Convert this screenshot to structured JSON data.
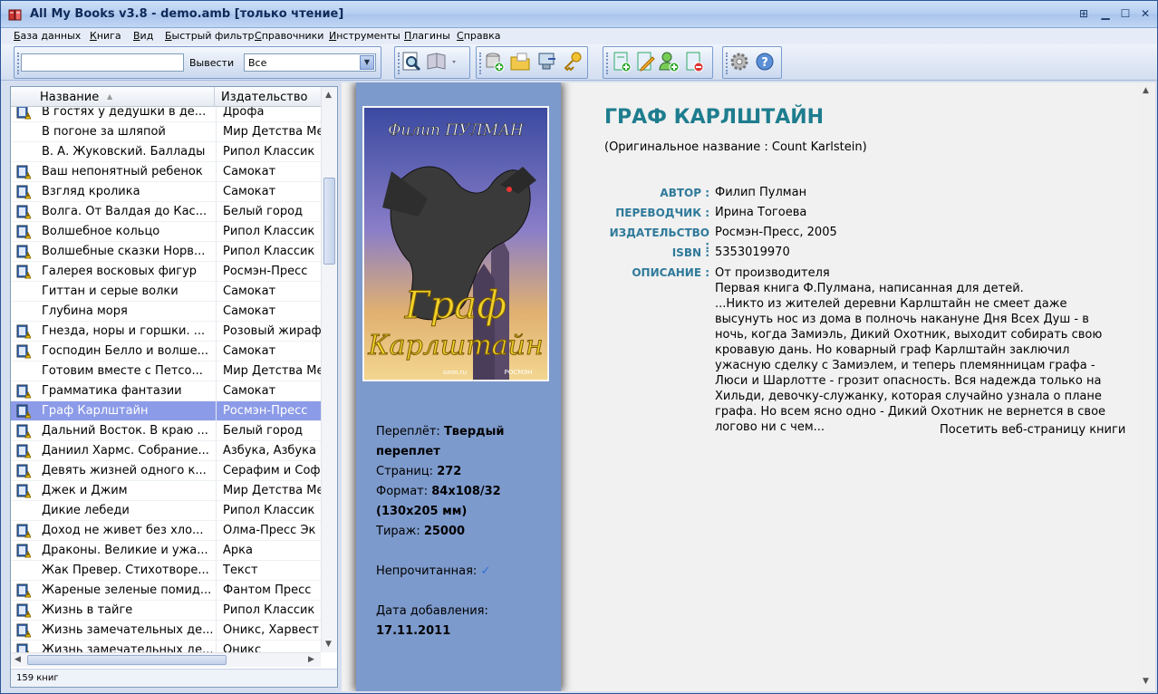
{
  "window": {
    "title": "All My Books v3.8 - demo.amb [только чтение]"
  },
  "menu": [
    "База данных",
    "Книга",
    "Вид",
    "Быстрый фильтр",
    "Справочники",
    "Инструменты",
    "Плагины",
    "Справка"
  ],
  "toolbar": {
    "search_value": "",
    "output_label": "Вывести",
    "filter_value": "Все",
    "icons": [
      "preview-icon",
      "reader-icon",
      "add-db-icon",
      "open-folder-icon",
      "export-icon",
      "key-icon",
      "add-book-icon",
      "edit-book-icon",
      "add-user-icon",
      "delete-book-icon",
      "settings-icon",
      "help-icon"
    ]
  },
  "list": {
    "col_title": "Название",
    "col_publisher": "Издательство",
    "rows": [
      {
        "title": "В гостях у дедушки в де...",
        "publisher": "Дрофа",
        "icon": true
      },
      {
        "title": "В погоне за шляпой",
        "publisher": "Мир Детства Ме",
        "icon": false
      },
      {
        "title": "В. А. Жуковский. Баллады",
        "publisher": "Рипол Классик",
        "icon": false
      },
      {
        "title": "Ваш непонятный ребенок",
        "publisher": "Самокат",
        "icon": true
      },
      {
        "title": "Взгляд кролика",
        "publisher": "Самокат",
        "icon": true
      },
      {
        "title": "Волга. От Валдая до Кас...",
        "publisher": "Белый город",
        "icon": true
      },
      {
        "title": "Волшебное кольцо",
        "publisher": "Рипол Классик",
        "icon": true
      },
      {
        "title": "Волшебные сказки Норв...",
        "publisher": "Рипол Классик",
        "icon": true
      },
      {
        "title": "Галерея восковых фигур",
        "publisher": "Росмэн-Пресс",
        "icon": true
      },
      {
        "title": "Гиттан и серые волки",
        "publisher": "Самокат",
        "icon": false
      },
      {
        "title": "Глубина моря",
        "publisher": "Самокат",
        "icon": false
      },
      {
        "title": "Гнезда, норы и горшки. ...",
        "publisher": "Розовый жираф",
        "icon": true
      },
      {
        "title": "Господин Белло и волше...",
        "publisher": "Самокат",
        "icon": true
      },
      {
        "title": "Готовим вместе с Петсо...",
        "publisher": "Мир Детства Ме",
        "icon": false
      },
      {
        "title": "Грамматика фантазии",
        "publisher": "Самокат",
        "icon": true
      },
      {
        "title": "Граф Карлштайн",
        "publisher": "Росмэн-Пресс",
        "icon": true,
        "selected": true
      },
      {
        "title": "Дальний Восток. В краю ...",
        "publisher": "Белый город",
        "icon": true
      },
      {
        "title": "Даниил Хармс. Собрание...",
        "publisher": "Азбука, Азбука",
        "icon": true
      },
      {
        "title": "Девять жизней одного к...",
        "publisher": "Серафим и Соф",
        "icon": true
      },
      {
        "title": "Джек и Джим",
        "publisher": "Мир Детства Ме",
        "icon": true
      },
      {
        "title": "Дикие лебеди",
        "publisher": "Рипол Классик",
        "icon": false
      },
      {
        "title": "Доход не живет без хло...",
        "publisher": "Олма-Пресс Эк",
        "icon": true
      },
      {
        "title": "Драконы. Великие и ужа...",
        "publisher": "Арка",
        "icon": true
      },
      {
        "title": "Жак Превер. Стихотворе...",
        "publisher": "Текст",
        "icon": false
      },
      {
        "title": "Жареные зеленые помид...",
        "publisher": "Фантом Пресс",
        "icon": true
      },
      {
        "title": "Жизнь в тайге",
        "publisher": "Рипол Классик",
        "icon": true
      },
      {
        "title": "Жизнь замечательных де...",
        "publisher": "Оникс, Харвест",
        "icon": true
      },
      {
        "title": "Жизнь замечательных де...",
        "publisher": "Оникс",
        "icon": true
      }
    ],
    "status": "159 книг"
  },
  "details": {
    "cover": {
      "author_line": "Филип ПУЛМАН",
      "title_line1": "Граф",
      "title_line2": "Карлштайн",
      "imprint_left": "ozon.ru",
      "imprint_right": "РОСМЭН"
    },
    "specs": {
      "binding_label": "Переплёт:",
      "binding_value1": "Твердый",
      "binding_value2": "переплет",
      "pages_label": "Страниц:",
      "pages_value": "272",
      "format_label": "Формат:",
      "format_value1": "84x108/32",
      "format_value2": "(130x205 мм)",
      "print_label": "Тираж:",
      "print_value": "25000",
      "unread_label": "Непрочитанная:",
      "added_label": "Дата добавления:",
      "added_value": "17.11.2011"
    },
    "title": "ГРАФ КАРЛШТАЙН",
    "original_name": "(Оригинальное название : Count Karlstein)",
    "fields": {
      "author_label": "АВТОР :",
      "author_value": "Филип Пулман",
      "translator_label": "ПЕРЕВОДЧИК :",
      "translator_value": "Ирина Тогоева",
      "publisher_label": "ИЗДАТЕЛЬСТВО :",
      "publisher_value": "Росмэн-Пресс, 2005",
      "isbn_label": "ISBN :",
      "isbn_value": "5353019970",
      "desc_label": "ОПИСАНИЕ :"
    },
    "description": "От производителя\nПервая книга Ф.Пулмана, написанная для детей.\n...Никто из жителей деревни Карлштайн не смеет даже высунуть нос из дома в полночь накануне Дня Всех Душ - в ночь, когда Замиэль, Дикий Охотник, выходит собирать свою кровавую дань. Но коварный граф Карлштайн заключил ужасную сделку с Замиэлем, и теперь племянницам графа - Люси и Шарлотте - грозит опасность. Вся надежда только на Хильди, девочку-служанку, которая случайно узнала о плане графа. Но всем ясно одно - Дикий Охотник не вернется в свое логово ни с чем...",
    "visit_link": "Посетить веб-страницу книги"
  },
  "colors": {
    "title_teal": "#1e7d8e",
    "label_blue": "#2f7a9a",
    "cover_band": "#7d9acc",
    "selection": "#8c9be8"
  }
}
